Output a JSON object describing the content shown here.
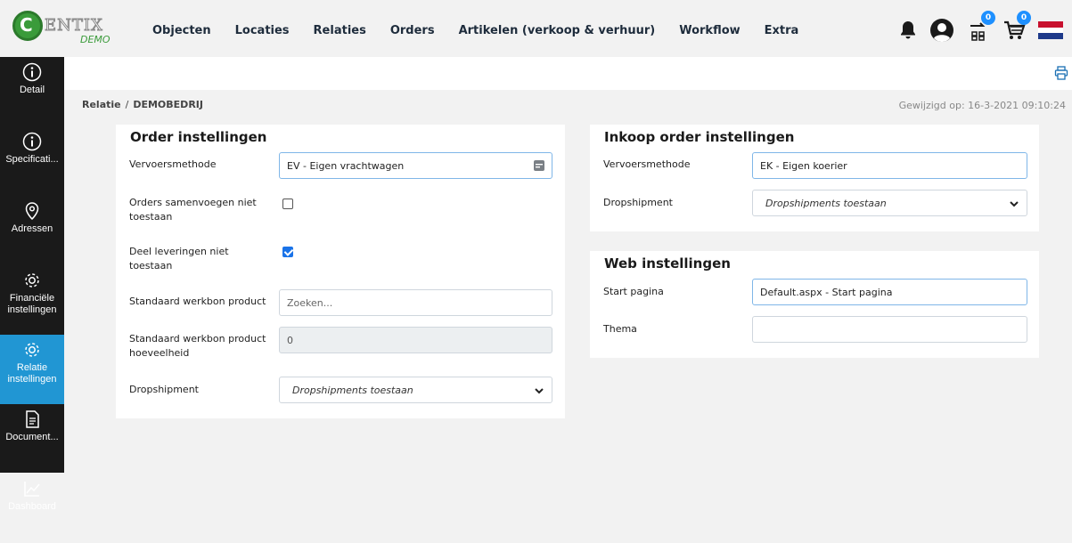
{
  "brand": {
    "logo_letter": "C",
    "logo_text": "ENTIX",
    "demo_label": "DEMO"
  },
  "nav": [
    "Objecten",
    "Locaties",
    "Relaties",
    "Orders",
    "Artikelen (verkoop & verhuur)",
    "Workflow",
    "Extra"
  ],
  "top_icons": {
    "notifications": "bell-icon",
    "user": "user-avatar-icon",
    "transfers_badge": "0",
    "cart_badge": "0"
  },
  "sidebar": [
    {
      "label": "Detail",
      "icon": "info-icon"
    },
    {
      "label": "Specificati...",
      "icon": "info-icon"
    },
    {
      "label": "Adressen",
      "icon": "location-pin-icon"
    },
    {
      "label": "Financiële",
      "label2": "instellingen",
      "icon": "gear-icon"
    },
    {
      "label": "Relatie",
      "label2": "instellingen",
      "icon": "gear-icon",
      "active": true
    },
    {
      "label": "Document...",
      "icon": "document-icon"
    },
    {
      "label": "Dashboard",
      "icon": "chart-icon"
    }
  ],
  "breadcrumb": {
    "first": "Relatie",
    "separator": "/",
    "current": "DEMOBEDRIJ"
  },
  "modified": "Gewijzigd op: 16-3-2021 09:10:24",
  "order_panel": {
    "title": "Order instellingen",
    "vervoer_label": "Vervoersmethode",
    "vervoer_value": "EV - Eigen vrachtwagen",
    "samenvoegen_label1": "Orders samenvoegen niet",
    "samenvoegen_label2": "toestaan",
    "samenvoegen_checked": false,
    "deel_label1": "Deel leveringen niet",
    "deel_label2": "toestaan",
    "deel_checked": true,
    "werkbon_label": "Standaard werkbon product",
    "werkbon_placeholder": "Zoeken...",
    "hoeveel_label1": "Standaard werkbon product",
    "hoeveel_label2": "hoeveelheid",
    "hoeveel_value": "0",
    "drop_label": "Dropshipment",
    "drop_value": "Dropshipments toestaan"
  },
  "inkoop_panel": {
    "title": "Inkoop order instellingen",
    "vervoer_label": "Vervoersmethode",
    "vervoer_value": "EK - Eigen koerier",
    "drop_label": "Dropshipment",
    "drop_value": "Dropshipments toestaan"
  },
  "web_panel": {
    "title": "Web instellingen",
    "start_label": "Start pagina",
    "start_value": "Default.aspx - Start pagina",
    "thema_label": "Thema",
    "thema_value": ""
  },
  "colors": {
    "accent": "#2196d3",
    "sidebar_bg": "#1a1a1a",
    "checkbox": "#1a73e8",
    "badge": "#1e90ff"
  }
}
